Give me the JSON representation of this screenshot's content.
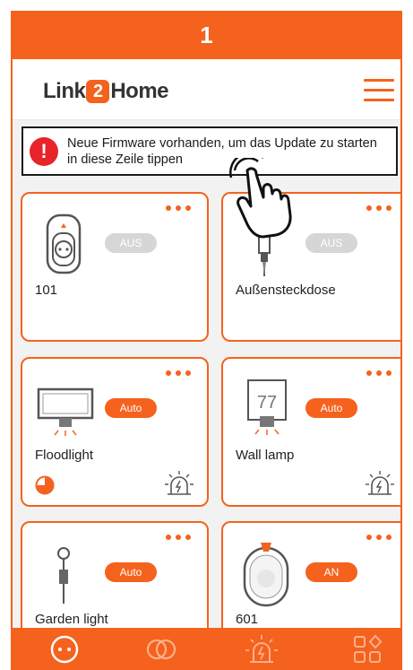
{
  "step": {
    "number": "1"
  },
  "header": {
    "logo_pre": "Link",
    "logo_num": "2",
    "logo_post": "Home"
  },
  "notice": {
    "line1": "Neue Firmware vorhanden, um das Update zu starten",
    "line2": "in diese Zeile tippen"
  },
  "devices": [
    {
      "name": "101",
      "state": "AUS",
      "icon": "smart-plug-icon"
    },
    {
      "name": "Außensteckdose",
      "state": "AUS",
      "icon": "outdoor-socket-icon"
    },
    {
      "name": "Floodlight",
      "state": "Auto",
      "icon": "floodlight-icon"
    },
    {
      "name": "Wall lamp",
      "state": "Auto",
      "icon": "wall-lamp-icon",
      "display": "77"
    },
    {
      "name": "Garden light",
      "state": "Auto",
      "icon": "garden-light-icon"
    },
    {
      "name": "601",
      "state": "AN",
      "icon": "siren-icon"
    }
  ],
  "nav": [
    "devices-icon",
    "groups-icon",
    "alarm-icon",
    "scenes-icon"
  ],
  "colors": {
    "accent": "#f5621d",
    "alert": "#e8232a",
    "pill_off": "#d6d6d6"
  }
}
